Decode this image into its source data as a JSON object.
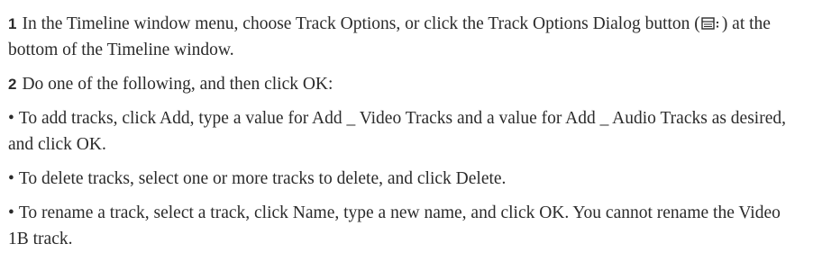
{
  "steps": [
    {
      "number": "1",
      "text_before_icon": "In the Timeline window menu, choose Track Options, or click the Track Options Dialog button (",
      "icon": "track-options-dialog-icon",
      "text_after_icon": ") at the bottom of the Timeline window."
    },
    {
      "number": "2",
      "text": "Do one of the following, and then click OK:"
    }
  ],
  "bullets": [
    {
      "symbol": "•",
      "text": "To add tracks, click Add, type a value for Add _ Video Tracks and a value for Add _ Audio Tracks as desired, and click OK."
    },
    {
      "symbol": "•",
      "text": "To delete tracks, select one or more tracks to delete, and click Delete."
    },
    {
      "symbol": "•",
      "text": "To rename a track, select a track, click Name, type a new name, and click OK. You cannot rename the Video 1B track."
    }
  ]
}
